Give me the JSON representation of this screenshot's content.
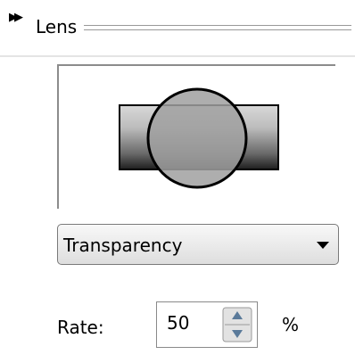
{
  "panel": {
    "title": "Lens"
  },
  "lens": {
    "mode": "Transparency",
    "rate_label": "Rate:",
    "rate_value": "50",
    "rate_unit": "%"
  },
  "colors": {
    "background": "#ffffff",
    "frame_border": "#8c8c8c",
    "dropdown_top": "#f8f8f8",
    "dropdown_bottom": "#dedede",
    "lens_fill": "#9a9a9a"
  },
  "icons": {
    "expand": "expand-double-arrow-icon",
    "dropdown": "chevron-down-icon",
    "spin_up": "spin-up-icon",
    "spin_down": "spin-down-icon"
  }
}
